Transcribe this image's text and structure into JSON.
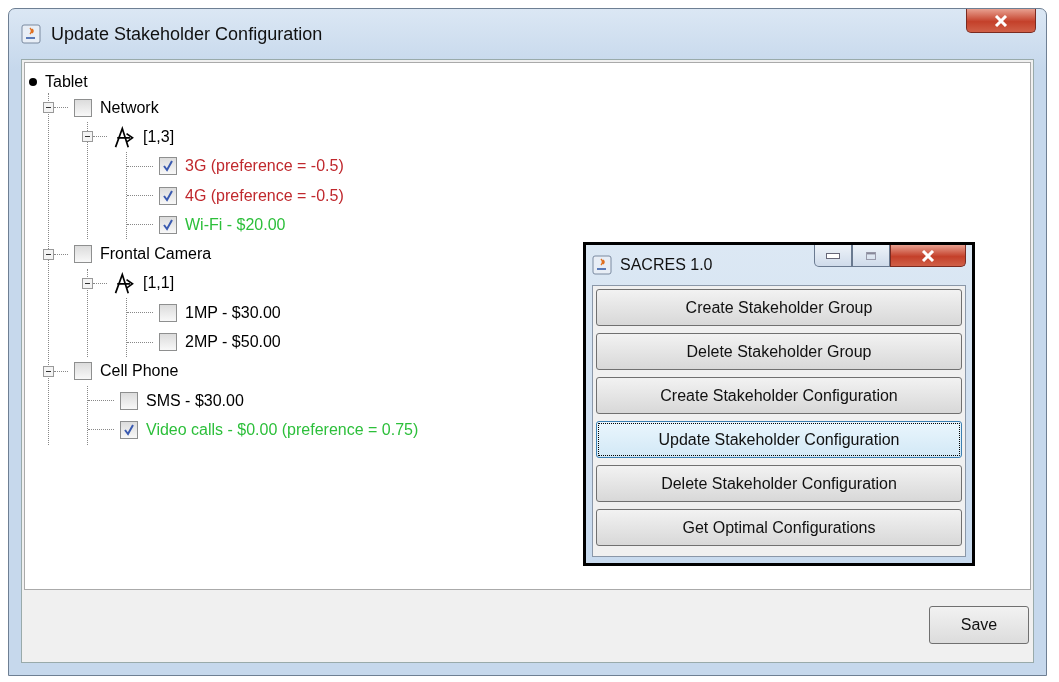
{
  "window": {
    "title": "Update Stakeholder Configuration"
  },
  "tree": {
    "root": {
      "label": "Tablet"
    },
    "children": [
      {
        "kind": "feature",
        "label": "Network",
        "checked": false,
        "expanded": true,
        "children": [
          {
            "kind": "group",
            "label": "[1,3]",
            "expanded": true,
            "children": [
              {
                "kind": "option",
                "label": "3G (preference = -0.5)",
                "checked": true,
                "color": "#c0282d"
              },
              {
                "kind": "option",
                "label": "4G (preference = -0.5)",
                "checked": true,
                "color": "#c0282d"
              },
              {
                "kind": "option",
                "label": "Wi-Fi - $20.00",
                "checked": true,
                "color": "#2cbf3a"
              }
            ]
          }
        ]
      },
      {
        "kind": "feature",
        "label": "Frontal Camera",
        "checked": false,
        "expanded": true,
        "children": [
          {
            "kind": "group",
            "label": "[1,1]",
            "expanded": true,
            "children": [
              {
                "kind": "option",
                "label": "1MP - $30.00",
                "checked": false,
                "color": "#000000"
              },
              {
                "kind": "option",
                "label": "2MP - $50.00",
                "checked": false,
                "color": "#000000"
              }
            ]
          }
        ]
      },
      {
        "kind": "feature",
        "label": "Cell Phone",
        "checked": false,
        "expanded": true,
        "children": [
          {
            "kind": "option",
            "label": "SMS - $30.00",
            "checked": false,
            "color": "#000000"
          },
          {
            "kind": "option",
            "label": "Video calls - $0.00 (preference = 0.75)",
            "checked": true,
            "color": "#2cbf3a"
          }
        ]
      }
    ]
  },
  "save_button": {
    "label": "Save"
  },
  "menu_window": {
    "title": "SACRES 1.0",
    "buttons": [
      {
        "label": "Create Stakeholder Group",
        "focused": false
      },
      {
        "label": "Delete Stakeholder Group",
        "focused": false
      },
      {
        "label": "Create Stakeholder Configuration",
        "focused": false
      },
      {
        "label": "Update Stakeholder Configuration",
        "focused": true
      },
      {
        "label": "Delete Stakeholder Configuration",
        "focused": false
      },
      {
        "label": "Get Optimal Configurations",
        "focused": false
      }
    ]
  }
}
